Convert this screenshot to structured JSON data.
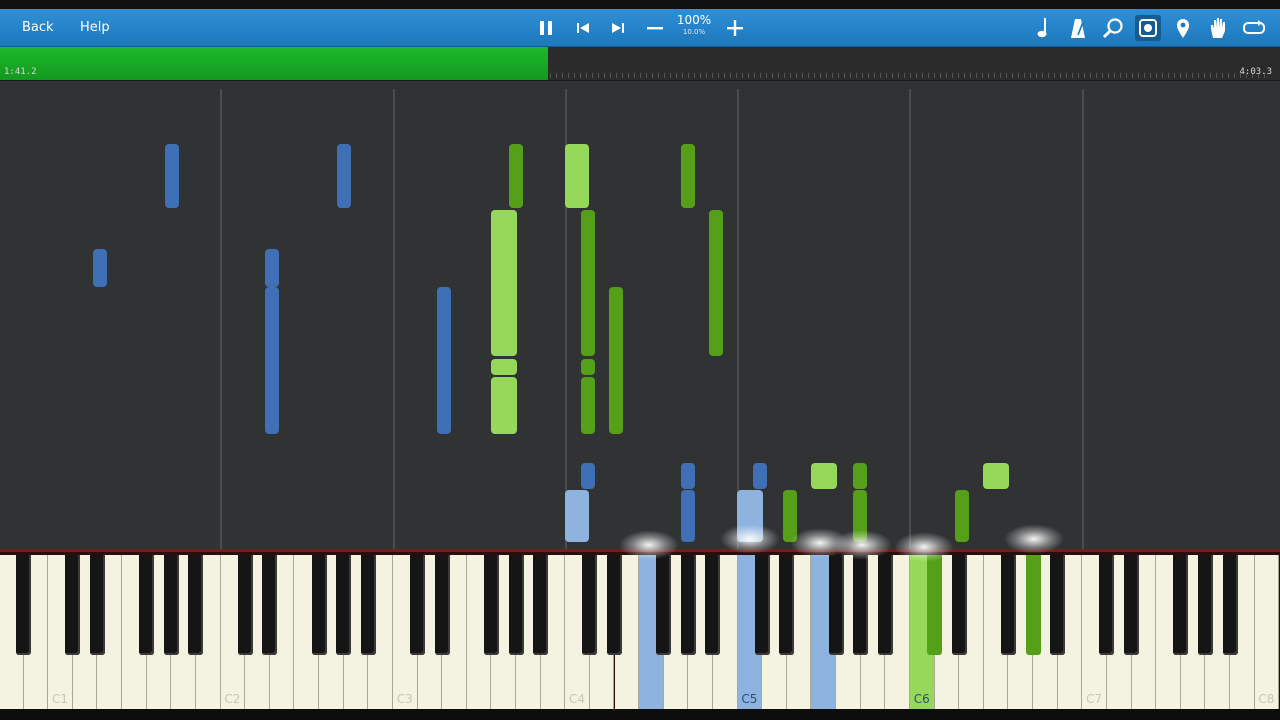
{
  "toolbar": {
    "back_label": "Back",
    "help_label": "Help",
    "zoom_percent": "100%",
    "zoom_sub": "10.0%",
    "icons": [
      "pause-icon",
      "skip-back-icon",
      "skip-forward-icon",
      "zoom-out-icon",
      "zoom-in-icon",
      "note-icon",
      "metronome-icon",
      "search-icon",
      "visualization-icon",
      "marker-icon",
      "hand-icon",
      "loop-icon"
    ]
  },
  "progress": {
    "elapsed": "1:41.2",
    "total": "4:03.3",
    "fraction": 0.428,
    "color": "#16a924"
  },
  "keyboard": {
    "octave_labels": [
      "C1",
      "C2",
      "C3",
      "C4",
      "C5",
      "C6",
      "C7",
      "C8"
    ]
  },
  "colors": {
    "left_hand": "#3f6fb5",
    "left_hand_light": "#8db3de",
    "right_hand_dark": "#55a018",
    "right_hand_light": "#96d85a"
  }
}
